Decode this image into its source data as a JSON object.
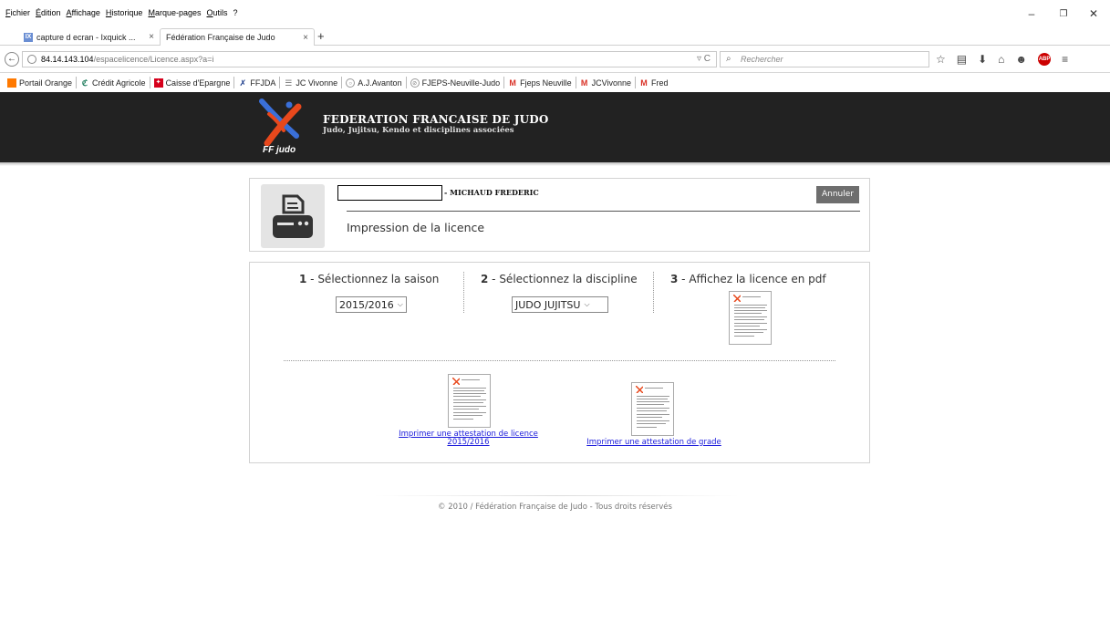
{
  "browser": {
    "menu": [
      "Fichier",
      "Édition",
      "Affichage",
      "Historique",
      "Marque-pages",
      "Outils",
      "?"
    ],
    "tabs": [
      {
        "label": "capture d ecran - Ixquick ...",
        "favicon": "ixquick-icon",
        "active": false
      },
      {
        "label": "Fédération Française de Judo",
        "favicon": "",
        "active": true
      }
    ],
    "url_host": "84.14.143.104",
    "url_path": "/espacelicence/Licence.aspx?a=i",
    "search_placeholder": "Rechercher",
    "bookmarks": [
      {
        "label": "Portail Orange",
        "icon": "orange-icon"
      },
      {
        "label": "Crédit Agricole",
        "icon": "credit-agricole-icon"
      },
      {
        "label": "Caisse d'Epargne",
        "icon": "caisse-epargne-icon"
      },
      {
        "label": "FFJDA",
        "icon": "ffjda-icon"
      },
      {
        "label": "JC Vivonne",
        "icon": "jc-icon"
      },
      {
        "label": "A.J.Avanton",
        "icon": "aj-icon"
      },
      {
        "label": "FJEPS-Neuville-Judo",
        "icon": "fjeps-icon"
      },
      {
        "label": "Fjeps Neuville",
        "icon": "gmail-icon"
      },
      {
        "label": "JCVivonne",
        "icon": "gmail-icon"
      },
      {
        "label": "Fred",
        "icon": "gmail-icon"
      }
    ]
  },
  "site": {
    "title": "FEDERATION FRANCAISE DE JUDO",
    "subtitle": "Judo, Jujitsu, Kendo et disciplines associées",
    "logo_text": "FF judo"
  },
  "licence": {
    "name": "- MICHAUD FREDERIC",
    "heading": "Impression de la licence",
    "cancel_label": "Annuler"
  },
  "steps": [
    {
      "num": "1",
      "label": " - Sélectionnez la saison"
    },
    {
      "num": "2",
      "label": " - Sélectionnez la discipline"
    },
    {
      "num": "3",
      "label": " - Affichez la licence en pdf"
    }
  ],
  "season_select": "2015/2016",
  "discipline_select": "JUDO JUJITSU",
  "attestations": {
    "licence_line1": "Imprimer une attestation de licence",
    "licence_line2": "2015/2016",
    "grade": "Imprimer une attestation de grade"
  },
  "footer": "© 2010 / Fédération Française de Judo - Tous droits réservés",
  "colors": {
    "header_bg": "#222222",
    "link": "#1a1adb",
    "logo_orange": "#e8481c",
    "logo_blue": "#3a6fd8"
  }
}
